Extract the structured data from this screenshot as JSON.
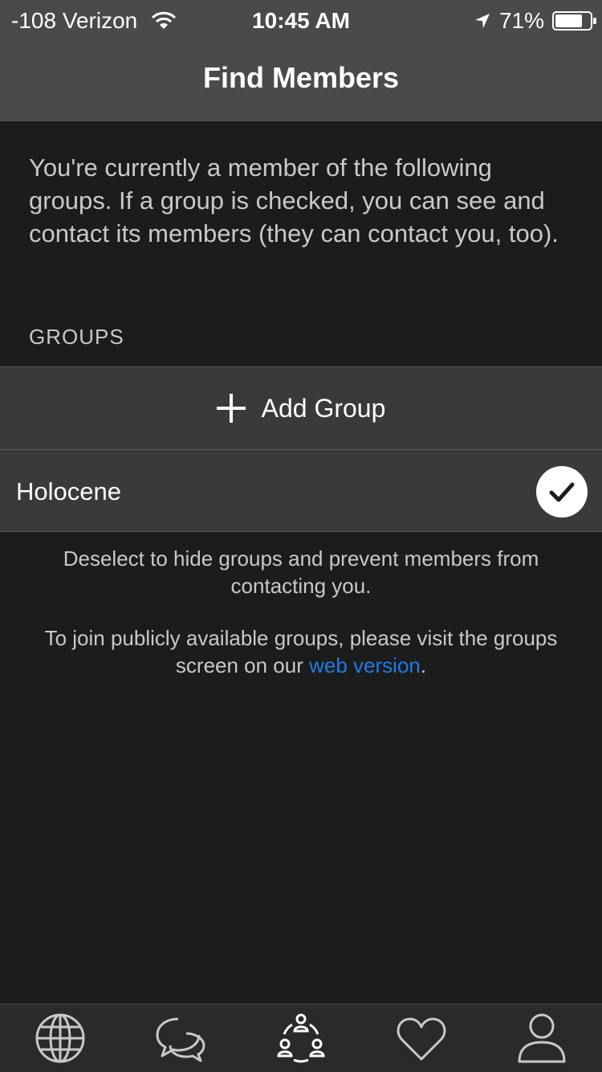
{
  "status": {
    "carrier": "-108 Verizon",
    "time": "10:45 AM",
    "battery_pct": "71%",
    "battery_level": 0.71
  },
  "nav": {
    "title": "Find Members"
  },
  "intro": "You're currently a member of the following groups. If a group is checked, you can see and contact its members (they can contact you, too).",
  "section_label": "GROUPS",
  "add_group_label": "Add Group",
  "groups": [
    {
      "name": "Holocene",
      "checked": true
    }
  ],
  "notes": {
    "hide": "Deselect to hide groups and prevent members from contacting you.",
    "join_prefix": "To join publicly available groups, please visit the groups screen on our ",
    "join_link": "web version",
    "join_suffix": "."
  },
  "tabs": [
    {
      "icon": "globe-icon"
    },
    {
      "icon": "chat-bubbles-icon"
    },
    {
      "icon": "group-network-icon",
      "active": true
    },
    {
      "icon": "heart-icon"
    },
    {
      "icon": "profile-icon"
    }
  ],
  "colors": {
    "background": "#1c1c1d",
    "nav_bar": "#4a4a4c",
    "row": "#3a3a3c",
    "link": "#1f7ae6"
  }
}
